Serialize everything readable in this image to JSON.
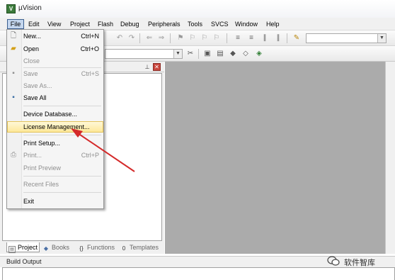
{
  "window": {
    "title": "µVision"
  },
  "menubar": {
    "items": [
      "File",
      "Edit",
      "View",
      "Project",
      "Flash",
      "Debug",
      "Peripherals",
      "Tools",
      "SVCS",
      "Window",
      "Help"
    ]
  },
  "file_menu": {
    "items": [
      {
        "label": "New...",
        "shortcut": "Ctrl+N",
        "icon": "new-file-icon",
        "enabled": true
      },
      {
        "label": "Open",
        "shortcut": "Ctrl+O",
        "icon": "open-folder-icon",
        "enabled": true
      },
      {
        "label": "Close",
        "shortcut": "",
        "icon": "",
        "enabled": false
      },
      {
        "label": "Save",
        "shortcut": "Ctrl+S",
        "icon": "save-icon",
        "enabled": false
      },
      {
        "label": "Save As...",
        "shortcut": "",
        "icon": "",
        "enabled": false
      },
      {
        "label": "Save All",
        "shortcut": "",
        "icon": "save-all-icon",
        "enabled": true
      },
      {
        "label": "Device Database...",
        "shortcut": "",
        "icon": "",
        "enabled": true
      },
      {
        "label": "License Management...",
        "shortcut": "",
        "icon": "",
        "enabled": true,
        "highlighted": true
      },
      {
        "label": "Print Setup...",
        "shortcut": "",
        "icon": "",
        "enabled": true
      },
      {
        "label": "Print...",
        "shortcut": "Ctrl+P",
        "icon": "print-icon",
        "enabled": false
      },
      {
        "label": "Print Preview",
        "shortcut": "",
        "icon": "",
        "enabled": false
      },
      {
        "label": "Recent Files",
        "shortcut": "",
        "icon": "",
        "enabled": false
      },
      {
        "label": "Exit",
        "shortcut": "",
        "icon": "",
        "enabled": true
      }
    ]
  },
  "project_panel": {
    "tabs": [
      {
        "label": "Project",
        "icon": "project-icon",
        "active": true
      },
      {
        "label": "Books",
        "icon": "books-icon",
        "active": false
      },
      {
        "label": "Functions",
        "icon": "functions-icon",
        "active": false
      },
      {
        "label": "Templates",
        "icon": "templates-icon",
        "active": false
      }
    ]
  },
  "build_output": {
    "title": "Build Output"
  },
  "watermark": {
    "text": "软件智库"
  },
  "colors": {
    "highlight": "#fde89a",
    "arrow": "#d42a2a",
    "editor_bg": "#ababab",
    "menu_active": "#c4d6ee"
  }
}
